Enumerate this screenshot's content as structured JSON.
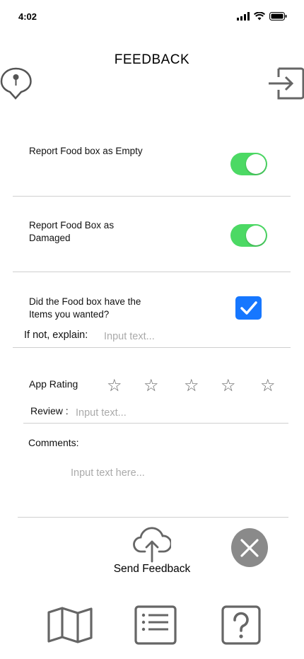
{
  "status_bar": {
    "time": "4:02"
  },
  "header": {
    "title": "FEEDBACK"
  },
  "report_empty": {
    "label": "Report Food box as Empty",
    "enabled": true
  },
  "report_damaged": {
    "label": "Report Food Box as Damaged",
    "enabled": true
  },
  "items_wanted": {
    "label": "Did the Food box have the Items you wanted?",
    "checked": true
  },
  "explain": {
    "label": "If not, explain:",
    "placeholder": "Input text..."
  },
  "rating": {
    "label": "App Rating",
    "max_stars": 5,
    "value": 0
  },
  "review": {
    "label": "Review :",
    "placeholder": "Input text..."
  },
  "comments": {
    "label": "Comments:",
    "placeholder": "Input text here..."
  },
  "actions": {
    "send_label": "Send Feedback"
  },
  "colors": {
    "toggle_on": "#4cd964",
    "checkbox": "#1677ff",
    "cancel": "#8a8a8a",
    "icon_gray": "#666666"
  },
  "nav_icons": [
    "map-icon",
    "list-icon",
    "help-icon"
  ]
}
